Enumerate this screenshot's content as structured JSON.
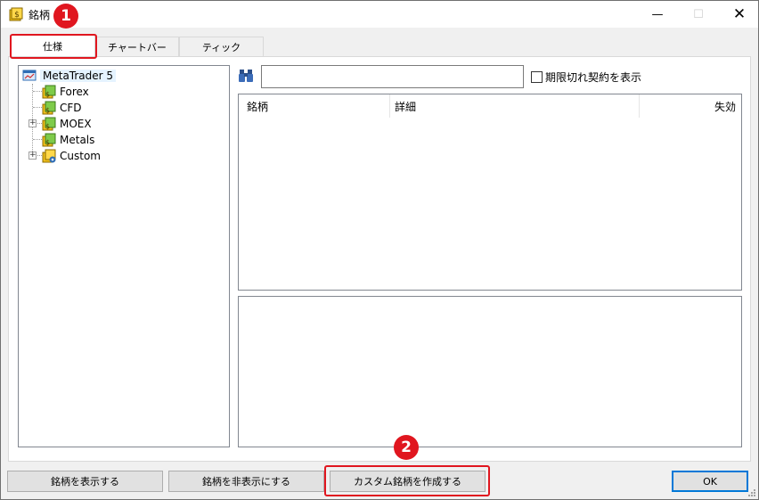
{
  "window": {
    "title": "銘柄",
    "minimize_symbol": "—",
    "maximize_symbol": "☐",
    "close_symbol": "✕"
  },
  "tabs": [
    {
      "label": "仕様",
      "active": true
    },
    {
      "label": "チャートバー",
      "active": false
    },
    {
      "label": "ティック",
      "active": false
    }
  ],
  "tree": {
    "root": "MetaTrader 5",
    "items": [
      {
        "label": "Forex",
        "expandable": false,
        "icon": "folder-dollar-icon"
      },
      {
        "label": "CFD",
        "expandable": false,
        "icon": "folder-dollar-icon"
      },
      {
        "label": "MOEX",
        "expandable": true,
        "icon": "folder-dollar-icon"
      },
      {
        "label": "Metals",
        "expandable": false,
        "icon": "folder-dollar-icon"
      },
      {
        "label": "Custom",
        "expandable": true,
        "icon": "folder-custom-icon"
      }
    ]
  },
  "search": {
    "value": "",
    "placeholder": "",
    "show_expired_label": "期限切れ契約を表示",
    "show_expired_checked": false
  },
  "symbols_table": {
    "columns": [
      "銘柄",
      "詳細",
      "失効"
    ],
    "rows": []
  },
  "buttons": {
    "show_symbol": "銘柄を表示する",
    "hide_symbol": "銘柄を非表示にする",
    "create_custom": "カスタム銘柄を作成する",
    "ok": "OK"
  },
  "callouts": [
    "1",
    "2"
  ],
  "colors": {
    "highlight": "#e0161f",
    "selection": "#e5f3ff",
    "ok_border": "#0078d7"
  }
}
